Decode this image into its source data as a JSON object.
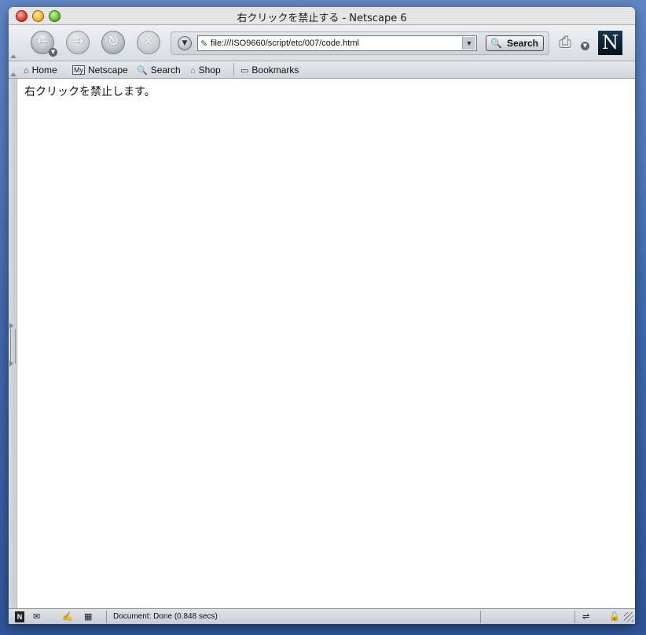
{
  "window": {
    "title": "右クリックを禁止する - Netscape 6"
  },
  "nav": {
    "back_glyph": "←",
    "forward_glyph": "→",
    "reload_glyph": "↻",
    "stop_glyph": "✕",
    "url": "file:///ISO9660/script/etc/007/code.html",
    "search_label": "Search",
    "logo_letter": "N"
  },
  "personal_toolbar": {
    "items": [
      {
        "label": "Home",
        "icon": "home-icon"
      },
      {
        "label": "Netscape",
        "icon": "my-netscape-icon",
        "badge": "My"
      },
      {
        "label": "Search",
        "icon": "search-icon"
      },
      {
        "label": "Shop",
        "icon": "shop-icon"
      },
      {
        "label": "Bookmarks",
        "icon": "bookmarks-folder-icon"
      }
    ]
  },
  "content": {
    "message": "右クリックを禁止します。"
  },
  "status": {
    "text": "Document: Done (0.848 secs)"
  },
  "colors": {
    "desktop": "#4a72b5",
    "chrome": "#d9dde3",
    "logo_bg": "#021019"
  }
}
